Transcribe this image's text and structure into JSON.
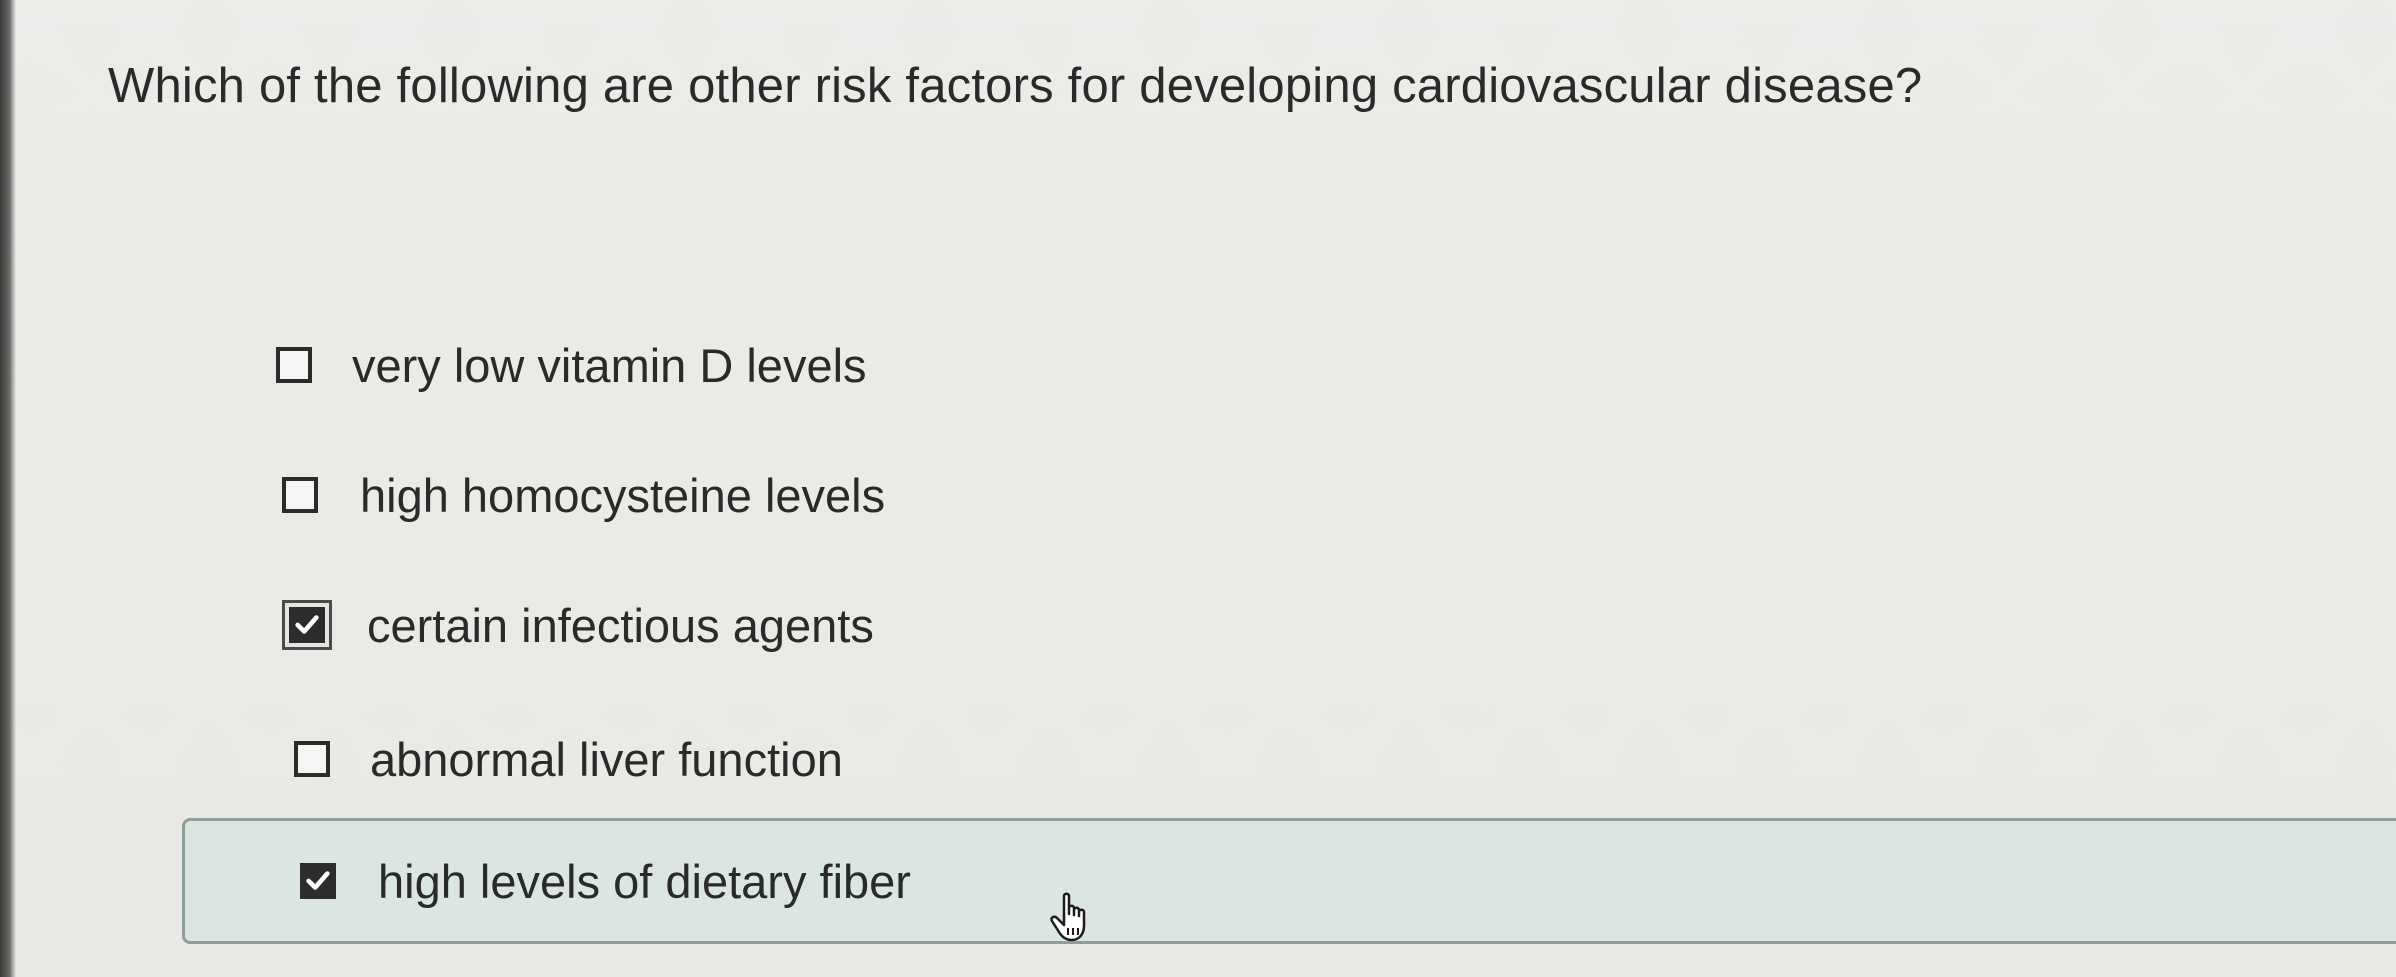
{
  "question": {
    "text": "Which of the following are other risk factors for developing cardiovascular disease?"
  },
  "options": [
    {
      "label": "very low vitamin D levels",
      "checked": false
    },
    {
      "label": "high homocysteine levels",
      "checked": false
    },
    {
      "label": "certain infectious agents",
      "checked": true
    },
    {
      "label": "abnormal liver function",
      "checked": false
    },
    {
      "label": "high levels of dietary fiber",
      "checked": true
    }
  ],
  "colors": {
    "background": "#ebebe9",
    "selected_row": "#dbe6e2",
    "checkbox": "#2c2c2c"
  },
  "icons": {
    "checkmark": "checkmark-icon",
    "cursor": "hand-pointer-icon"
  }
}
